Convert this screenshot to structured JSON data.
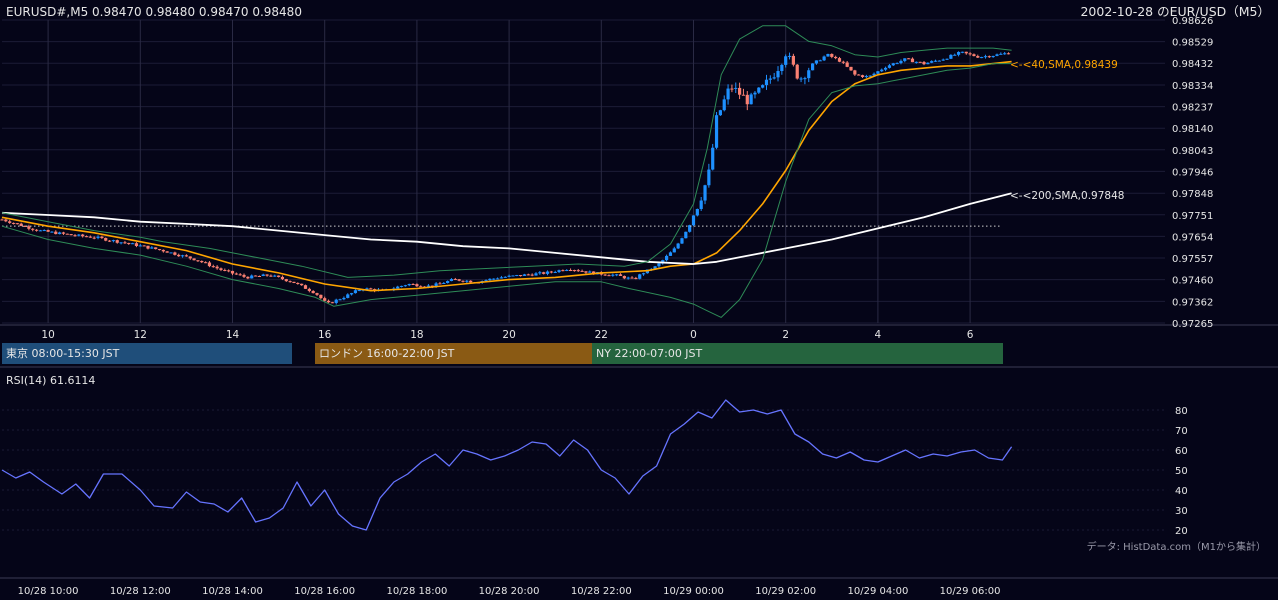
{
  "header": {
    "symbol_info": "EURUSD#,M5 0.98470 0.98480 0.98470 0.98480",
    "chart_title": "2002-10-28 のEUR/USD（M5）"
  },
  "colors": {
    "background": "#050518",
    "grid": "#1c1c36",
    "bull": "#1e90ff",
    "bear": "#fa8072",
    "sma40": "#ffa500",
    "sma200": "#ffffff",
    "bollinger": "#2e8b57",
    "rsi": "#6674ff",
    "session_tokyo": "#1f4e7a",
    "session_london": "#8a5a14",
    "session_ny": "#25643e"
  },
  "sessions": [
    {
      "label": "東京 08:00-15:30 JST",
      "start": 8.0,
      "end": 15.5,
      "color": "#1f4e7a"
    },
    {
      "label": "ロンドン 16:00-22:00 JST",
      "start": 16.0,
      "end": 22.0,
      "color": "#8a5a14"
    },
    {
      "label": "NY 22:00-07:00 JST",
      "start": 22.0,
      "end": 31.0,
      "color": "#25643e"
    }
  ],
  "price_axis_ticks": [
    "0.98626",
    "0.98529",
    "0.98432",
    "0.98334",
    "0.98237",
    "0.98140",
    "0.98043",
    "0.97946",
    "0.97848",
    "0.97751",
    "0.97654",
    "0.97557",
    "0.97460",
    "0.97362",
    "0.97265"
  ],
  "hour_axis_ticks": [
    {
      "label": "10",
      "h": 10
    },
    {
      "label": "12",
      "h": 12
    },
    {
      "label": "14",
      "h": 14
    },
    {
      "label": "16",
      "h": 16
    },
    {
      "label": "18",
      "h": 18
    },
    {
      "label": "20",
      "h": 20
    },
    {
      "label": "22",
      "h": 22
    },
    {
      "label": "0",
      "h": 24
    },
    {
      "label": "2",
      "h": 26
    },
    {
      "label": "4",
      "h": 28
    },
    {
      "label": "6",
      "h": 30
    }
  ],
  "date_axis_ticks": [
    {
      "label": "10/28 10:00",
      "h": 10
    },
    {
      "label": "10/28 12:00",
      "h": 12
    },
    {
      "label": "10/28 14:00",
      "h": 14
    },
    {
      "label": "10/28 16:00",
      "h": 16
    },
    {
      "label": "10/28 18:00",
      "h": 18
    },
    {
      "label": "10/28 20:00",
      "h": 20
    },
    {
      "label": "10/28 22:00",
      "h": 22
    },
    {
      "label": "10/29 00:00",
      "h": 24
    },
    {
      "label": "10/29 02:00",
      "h": 26
    },
    {
      "label": "10/29 04:00",
      "h": 28
    },
    {
      "label": "10/29 06:00",
      "h": 30
    }
  ],
  "annotations": {
    "sma40_label": "<-<40,SMA,0.98439",
    "sma200_label": "<-<200,SMA,0.97848",
    "rsi_label": "RSI(14) 61.6114",
    "source": "データ: HistData.com（M1から集計）"
  },
  "rsi_axis_ticks": [
    "80",
    "70",
    "60",
    "50",
    "40",
    "30",
    "20"
  ],
  "chart_data": [
    {
      "type": "candlestick",
      "title": "2002-10-28 のEUR/USD（M5）",
      "x_range_hours": [
        9.0,
        31.0
      ],
      "ylim": [
        0.97265,
        0.98626
      ],
      "reference_level": 0.977,
      "close_path": [
        [
          9.0,
          0.9773
        ],
        [
          9.8,
          0.9768
        ],
        [
          10.5,
          0.9766
        ],
        [
          11.0,
          0.9765
        ],
        [
          11.8,
          0.9762
        ],
        [
          12.5,
          0.9759
        ],
        [
          13.2,
          0.9755
        ],
        [
          13.8,
          0.975
        ],
        [
          14.3,
          0.9747
        ],
        [
          14.8,
          0.9748
        ],
        [
          15.3,
          0.9745
        ],
        [
          15.8,
          0.974
        ],
        [
          16.05,
          0.9735
        ],
        [
          16.4,
          0.9738
        ],
        [
          16.8,
          0.9742
        ],
        [
          17.3,
          0.9741
        ],
        [
          17.8,
          0.9744
        ],
        [
          18.3,
          0.9743
        ],
        [
          18.8,
          0.9746
        ],
        [
          19.3,
          0.9745
        ],
        [
          19.8,
          0.9747
        ],
        [
          20.3,
          0.9748
        ],
        [
          20.8,
          0.9749
        ],
        [
          21.3,
          0.9751
        ],
        [
          21.8,
          0.9749
        ],
        [
          22.3,
          0.9748
        ],
        [
          22.7,
          0.9746
        ],
        [
          22.9,
          0.9749
        ],
        [
          23.2,
          0.9752
        ],
        [
          23.6,
          0.976
        ],
        [
          23.9,
          0.977
        ],
        [
          24.2,
          0.9785
        ],
        [
          24.35,
          0.9795
        ],
        [
          24.5,
          0.9818
        ],
        [
          24.8,
          0.9833
        ],
        [
          25.2,
          0.9826
        ],
        [
          25.5,
          0.9832
        ],
        [
          25.8,
          0.984
        ],
        [
          26.0,
          0.9848
        ],
        [
          26.3,
          0.9836
        ],
        [
          26.6,
          0.9843
        ],
        [
          26.9,
          0.9847
        ],
        [
          27.2,
          0.9844
        ],
        [
          27.5,
          0.9838
        ],
        [
          27.8,
          0.9837
        ],
        [
          28.2,
          0.9842
        ],
        [
          28.6,
          0.9845
        ],
        [
          29.0,
          0.9843
        ],
        [
          29.4,
          0.9845
        ],
        [
          29.8,
          0.9848
        ],
        [
          30.2,
          0.9846
        ],
        [
          30.6,
          0.9847
        ],
        [
          30.9,
          0.9848
        ]
      ],
      "series": [
        {
          "name": "40,SMA",
          "last": 0.98439,
          "points": [
            [
              9.0,
              0.9774
            ],
            [
              10.0,
              0.977
            ],
            [
              11.0,
              0.9767
            ],
            [
              12.0,
              0.9763
            ],
            [
              13.0,
              0.9759
            ],
            [
              14.0,
              0.9753
            ],
            [
              15.0,
              0.9749
            ],
            [
              16.0,
              0.9744
            ],
            [
              17.0,
              0.9741
            ],
            [
              18.0,
              0.9742
            ],
            [
              19.0,
              0.9744
            ],
            [
              20.0,
              0.9746
            ],
            [
              21.0,
              0.9747
            ],
            [
              22.0,
              0.9749
            ],
            [
              23.0,
              0.975
            ],
            [
              23.5,
              0.9752
            ],
            [
              24.0,
              0.9753
            ],
            [
              24.5,
              0.9758
            ],
            [
              25.0,
              0.9768
            ],
            [
              25.5,
              0.978
            ],
            [
              26.0,
              0.9795
            ],
            [
              26.5,
              0.9813
            ],
            [
              27.0,
              0.9826
            ],
            [
              27.5,
              0.9834
            ],
            [
              28.0,
              0.9838
            ],
            [
              28.5,
              0.984
            ],
            [
              29.0,
              0.9841
            ],
            [
              29.5,
              0.9842
            ],
            [
              30.0,
              0.9842
            ],
            [
              30.5,
              0.9843
            ],
            [
              30.9,
              0.98439
            ]
          ]
        },
        {
          "name": "200,SMA",
          "last": 0.97848,
          "points": [
            [
              9.0,
              0.9776
            ],
            [
              10.0,
              0.9775
            ],
            [
              11.0,
              0.9774
            ],
            [
              12.0,
              0.9772
            ],
            [
              13.0,
              0.9771
            ],
            [
              14.0,
              0.977
            ],
            [
              15.0,
              0.9768
            ],
            [
              16.0,
              0.9766
            ],
            [
              17.0,
              0.9764
            ],
            [
              18.0,
              0.9763
            ],
            [
              19.0,
              0.9761
            ],
            [
              20.0,
              0.976
            ],
            [
              21.0,
              0.9758
            ],
            [
              22.0,
              0.9756
            ],
            [
              23.0,
              0.9754
            ],
            [
              24.0,
              0.9753
            ],
            [
              24.5,
              0.9754
            ],
            [
              25.0,
              0.9756
            ],
            [
              26.0,
              0.976
            ],
            [
              27.0,
              0.9764
            ],
            [
              28.0,
              0.9769
            ],
            [
              29.0,
              0.9774
            ],
            [
              30.0,
              0.978
            ],
            [
              30.9,
              0.97848
            ]
          ]
        },
        {
          "name": "bollinger_upper",
          "points": [
            [
              9.0,
              0.9776
            ],
            [
              10.0,
              0.9772
            ],
            [
              11.0,
              0.9768
            ],
            [
              12.0,
              0.9765
            ],
            [
              12.5,
              0.9763
            ],
            [
              13.5,
              0.976
            ],
            [
              14.5,
              0.9756
            ],
            [
              15.5,
              0.9752
            ],
            [
              16.5,
              0.9747
            ],
            [
              17.5,
              0.9748
            ],
            [
              18.5,
              0.975
            ],
            [
              19.5,
              0.9751
            ],
            [
              20.5,
              0.9752
            ],
            [
              21.5,
              0.9753
            ],
            [
              22.5,
              0.9752
            ],
            [
              23.0,
              0.9754
            ],
            [
              23.5,
              0.9762
            ],
            [
              24.0,
              0.978
            ],
            [
              24.3,
              0.9805
            ],
            [
              24.6,
              0.9838
            ],
            [
              25.0,
              0.9854
            ],
            [
              25.5,
              0.986
            ],
            [
              26.0,
              0.986
            ],
            [
              26.5,
              0.9853
            ],
            [
              27.0,
              0.9851
            ],
            [
              27.5,
              0.9847
            ],
            [
              28.0,
              0.9846
            ],
            [
              28.5,
              0.9848
            ],
            [
              29.0,
              0.9849
            ],
            [
              29.5,
              0.985
            ],
            [
              30.0,
              0.985
            ],
            [
              30.5,
              0.985
            ],
            [
              30.9,
              0.9849
            ]
          ]
        },
        {
          "name": "bollinger_lower",
          "points": [
            [
              9.0,
              0.977
            ],
            [
              10.0,
              0.9764
            ],
            [
              11.0,
              0.976
            ],
            [
              12.0,
              0.9757
            ],
            [
              13.0,
              0.9752
            ],
            [
              14.0,
              0.9746
            ],
            [
              15.0,
              0.9742
            ],
            [
              15.8,
              0.9738
            ],
            [
              16.2,
              0.9734
            ],
            [
              17.0,
              0.9737
            ],
            [
              18.0,
              0.9739
            ],
            [
              19.0,
              0.9741
            ],
            [
              20.0,
              0.9743
            ],
            [
              21.0,
              0.9745
            ],
            [
              22.0,
              0.9745
            ],
            [
              22.6,
              0.9742
            ],
            [
              23.5,
              0.9738
            ],
            [
              24.0,
              0.9735
            ],
            [
              24.3,
              0.9732
            ],
            [
              24.6,
              0.9729
            ],
            [
              25.0,
              0.9737
            ],
            [
              25.5,
              0.9755
            ],
            [
              26.0,
              0.979
            ],
            [
              26.5,
              0.9818
            ],
            [
              27.0,
              0.983
            ],
            [
              27.5,
              0.9833
            ],
            [
              28.0,
              0.9834
            ],
            [
              28.5,
              0.9836
            ],
            [
              29.0,
              0.9838
            ],
            [
              29.5,
              0.984
            ],
            [
              30.0,
              0.9841
            ],
            [
              30.5,
              0.9843
            ],
            [
              30.9,
              0.9843
            ]
          ]
        }
      ]
    },
    {
      "type": "line",
      "title": "RSI(14) 61.6114",
      "ylim": [
        20,
        80
      ],
      "x_range_hours": [
        9.0,
        31.0
      ],
      "series": [
        {
          "name": "RSI(14)",
          "last": 61.6114,
          "points": [
            [
              9.0,
              50
            ],
            [
              9.3,
              46
            ],
            [
              9.6,
              49
            ],
            [
              9.9,
              44
            ],
            [
              10.3,
              38
            ],
            [
              10.6,
              43
            ],
            [
              10.9,
              36
            ],
            [
              11.2,
              48
            ],
            [
              11.6,
              48
            ],
            [
              12.0,
              40
            ],
            [
              12.3,
              32
            ],
            [
              12.7,
              31
            ],
            [
              13.0,
              39
            ],
            [
              13.3,
              34
            ],
            [
              13.6,
              33
            ],
            [
              13.9,
              29
            ],
            [
              14.2,
              36
            ],
            [
              14.5,
              24
            ],
            [
              14.8,
              26
            ],
            [
              15.1,
              31
            ],
            [
              15.4,
              44
            ],
            [
              15.7,
              32
            ],
            [
              16.0,
              40
            ],
            [
              16.3,
              28
            ],
            [
              16.6,
              22
            ],
            [
              16.9,
              20
            ],
            [
              17.2,
              36
            ],
            [
              17.5,
              44
            ],
            [
              17.8,
              48
            ],
            [
              18.1,
              54
            ],
            [
              18.4,
              58
            ],
            [
              18.7,
              52
            ],
            [
              19.0,
              60
            ],
            [
              19.3,
              58
            ],
            [
              19.6,
              55
            ],
            [
              19.9,
              57
            ],
            [
              20.2,
              60
            ],
            [
              20.5,
              64
            ],
            [
              20.8,
              63
            ],
            [
              21.1,
              57
            ],
            [
              21.4,
              65
            ],
            [
              21.7,
              60
            ],
            [
              22.0,
              50
            ],
            [
              22.3,
              46
            ],
            [
              22.6,
              38
            ],
            [
              22.9,
              47
            ],
            [
              23.2,
              52
            ],
            [
              23.5,
              68
            ],
            [
              23.8,
              73
            ],
            [
              24.1,
              79
            ],
            [
              24.4,
              76
            ],
            [
              24.7,
              85
            ],
            [
              25.0,
              79
            ],
            [
              25.3,
              80
            ],
            [
              25.6,
              78
            ],
            [
              25.9,
              80
            ],
            [
              26.2,
              68
            ],
            [
              26.5,
              64
            ],
            [
              26.8,
              58
            ],
            [
              27.1,
              56
            ],
            [
              27.4,
              59
            ],
            [
              27.7,
              55
            ],
            [
              28.0,
              54
            ],
            [
              28.3,
              57
            ],
            [
              28.6,
              60
            ],
            [
              28.9,
              56
            ],
            [
              29.2,
              58
            ],
            [
              29.5,
              57
            ],
            [
              29.8,
              59
            ],
            [
              30.1,
              60
            ],
            [
              30.4,
              56
            ],
            [
              30.7,
              55
            ],
            [
              30.9,
              61.6
            ]
          ]
        }
      ]
    }
  ]
}
